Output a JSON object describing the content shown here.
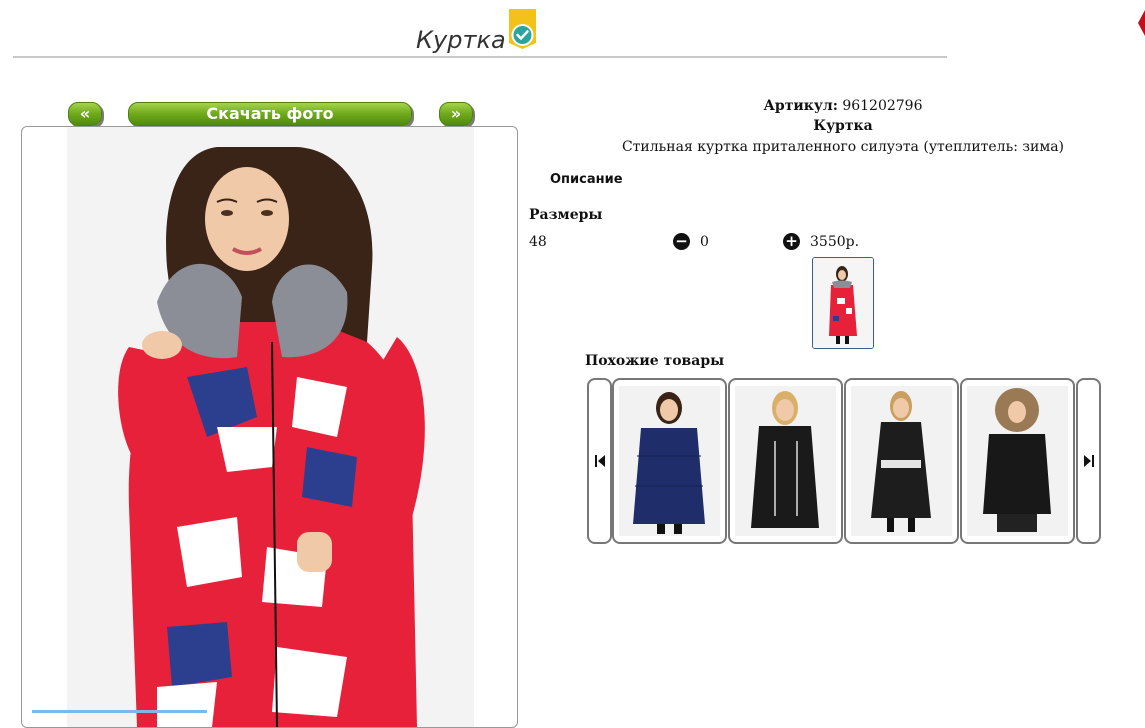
{
  "header": {
    "title": "Куртка"
  },
  "photo_nav": {
    "prev_label": "«",
    "download_label": "Скачать фото",
    "next_label": "»"
  },
  "product": {
    "article_label": "Артикул:",
    "article_value": "961202796",
    "name": "Куртка",
    "description": "Стильная куртка приталенного силуэта (утеплитель: зима)",
    "description_heading": "Описание",
    "sizes_heading": "Размеры",
    "size": "48",
    "quantity": "0",
    "price": "3550р."
  },
  "similar": {
    "heading": "Похожие товары",
    "prev_icon": "skip-previous-icon",
    "next_icon": "skip-next-icon",
    "items": [
      {
        "color": "#1f2e6b",
        "name": "navy-puffer-jacket"
      },
      {
        "color": "#1a1a1a",
        "name": "black-jacket-white-trim"
      },
      {
        "color": "#1d1d1d",
        "name": "black-belted-coat"
      },
      {
        "color": "#181818",
        "name": "black-fur-hood-jacket"
      }
    ]
  },
  "colors": {
    "accent_green": "#6fa91b",
    "jacket_red": "#e8213a",
    "badge_yellow": "#f2c21b",
    "badge_teal": "#2aa59a"
  }
}
